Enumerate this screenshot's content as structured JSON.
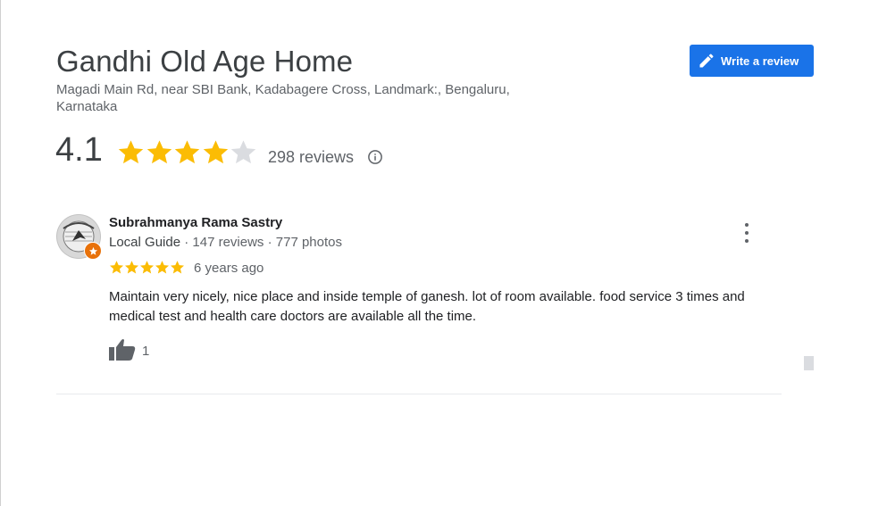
{
  "place": {
    "name": "Gandhi Old Age Home",
    "address": "Magadi Main Rd, near SBI Bank, Kadabagere Cross, Landmark:, Bengaluru, Karnataka"
  },
  "actions": {
    "write_review_label": "Write a review"
  },
  "rating": {
    "value": "4.1",
    "stars": 4,
    "max_stars": 5,
    "reviews_label": "298 reviews"
  },
  "review": {
    "author": "Subrahmanya Rama Sastry",
    "badge": "Local Guide",
    "reviews_count": " · 147 reviews",
    "photos_count": " · 777 photos",
    "stars": 5,
    "date": "6 years ago",
    "text": "Maintain very nicely, nice place and inside temple of ganesh. lot of room available. food service 3 times and medical test and health care doctors are available all the time.",
    "likes": "1"
  },
  "colors": {
    "accent": "#1a73e8",
    "star_filled": "#fbbc04",
    "star_empty": "#dadce0",
    "local_guide_badge": "#e8710a"
  },
  "icons": [
    "pencil-icon",
    "info-icon",
    "more-vert-icon",
    "thumb-up-icon",
    "local-guide-star-icon"
  ]
}
